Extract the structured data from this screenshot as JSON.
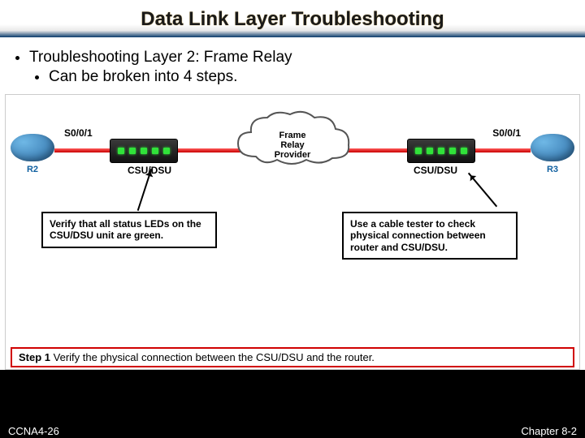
{
  "title": "Data Link Layer Troubleshooting",
  "bullet1": "Troubleshooting Layer 2: Frame Relay",
  "bullet2": "Can be broken into 4 steps.",
  "left_router": "R2",
  "right_router": "R3",
  "left_if": "S0/0/1",
  "right_if": "S0/0/1",
  "csu_label": "CSU/DSU",
  "cloud_line1": "Frame",
  "cloud_line2": "Relay",
  "cloud_line3": "Provider",
  "callout_left": "Verify that all status LEDs on the CSU/DSU unit are green.",
  "callout_right": "Use a cable tester to check physical connection between router and CSU/DSU.",
  "step_label": "Step 1",
  "step_text": "Verify the physical connection between the CSU/DSU and the router.",
  "footer_left": "CCNA4-26",
  "footer_right": "Chapter 8-2"
}
